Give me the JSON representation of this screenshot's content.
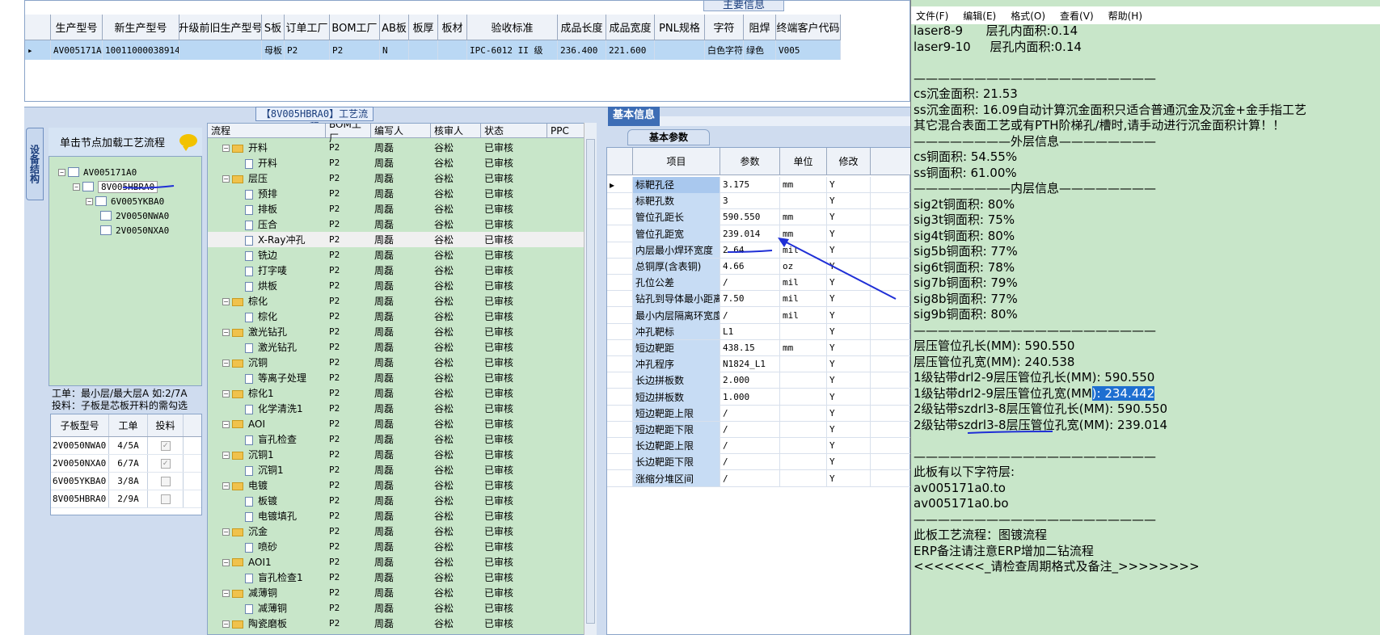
{
  "top_panel": {
    "tab_label": "主要信息",
    "headers": [
      "生产型号",
      "新生产型号",
      "升级前旧生产型号",
      "S板",
      "订单工厂",
      "BOM工厂",
      "AB板",
      "板厚",
      "板材",
      "验收标准",
      "成品长度",
      "成品宽度",
      "PNL规格",
      "字符",
      "阻焊",
      "终端客户代码"
    ],
    "row": [
      "AV005171A0",
      "10011000038914",
      "",
      "母板",
      "P2",
      "P2",
      "N",
      "",
      "",
      "IPC-6012 II 级",
      "236.400",
      "221.600",
      "",
      "白色字符",
      "绿色",
      "V005"
    ]
  },
  "side_tab": "设备结构",
  "tree_panel": {
    "header": "单击节点加载工艺流程",
    "nodes": [
      "AV005171A0",
      "8V005HBRA0",
      "6V005YKBA0",
      "2V0050NWA0",
      "2V0050NXA0"
    ]
  },
  "info_text": {
    "line1": "工单：最小层/最大层A 如:2/7A",
    "line2": "投料：子板是芯板开料的需勾选"
  },
  "child_grid": {
    "headers": [
      "子板型号",
      "工单",
      "投料"
    ],
    "rows": [
      {
        "model": "2V0050NWA0",
        "order": "4/5A",
        "checked": "✓"
      },
      {
        "model": "2V0050NXA0",
        "order": "6/7A",
        "checked": "✓"
      },
      {
        "model": "6V005YKBA0",
        "order": "3/8A",
        "checked": ""
      },
      {
        "model": "8V005HBRA0",
        "order": "2/9A",
        "checked": ""
      }
    ]
  },
  "process_panel": {
    "tab_label": "【8V005HBRA0】工艺流程",
    "headers": [
      "流程",
      "BOM工厂",
      "编写人",
      "核审人",
      "状态",
      "PPC"
    ],
    "rows": [
      {
        "name": "开料",
        "type": "folder",
        "bom": "P2",
        "writer": "周磊",
        "checker": "谷松",
        "status": "已审核"
      },
      {
        "name": "开料",
        "type": "doc",
        "bom": "P2",
        "writer": "周磊",
        "checker": "谷松",
        "status": "已审核"
      },
      {
        "name": "层压",
        "type": "folder",
        "bom": "P2",
        "writer": "周磊",
        "checker": "谷松",
        "status": "已审核"
      },
      {
        "name": "预排",
        "type": "doc",
        "bom": "P2",
        "writer": "周磊",
        "checker": "谷松",
        "status": "已审核"
      },
      {
        "name": "排板",
        "type": "doc",
        "bom": "P2",
        "writer": "周磊",
        "checker": "谷松",
        "status": "已审核"
      },
      {
        "name": "压合",
        "type": "doc",
        "bom": "P2",
        "writer": "周磊",
        "checker": "谷松",
        "status": "已审核"
      },
      {
        "name": "X-Ray冲孔",
        "type": "doc",
        "bom": "P2",
        "writer": "周磊",
        "checker": "谷松",
        "status": "已审核"
      },
      {
        "name": "铣边",
        "type": "doc",
        "bom": "P2",
        "writer": "周磊",
        "checker": "谷松",
        "status": "已审核"
      },
      {
        "name": "打字唛",
        "type": "doc",
        "bom": "P2",
        "writer": "周磊",
        "checker": "谷松",
        "status": "已审核"
      },
      {
        "name": "烘板",
        "type": "doc",
        "bom": "P2",
        "writer": "周磊",
        "checker": "谷松",
        "status": "已审核"
      },
      {
        "name": "棕化",
        "type": "folder",
        "bom": "P2",
        "writer": "周磊",
        "checker": "谷松",
        "status": "已审核"
      },
      {
        "name": "棕化",
        "type": "doc",
        "bom": "P2",
        "writer": "周磊",
        "checker": "谷松",
        "status": "已审核"
      },
      {
        "name": "激光钻孔",
        "type": "folder",
        "bom": "P2",
        "writer": "周磊",
        "checker": "谷松",
        "status": "已审核"
      },
      {
        "name": "激光钻孔",
        "type": "doc",
        "bom": "P2",
        "writer": "周磊",
        "checker": "谷松",
        "status": "已审核"
      },
      {
        "name": "沉铜",
        "type": "folder",
        "bom": "P2",
        "writer": "周磊",
        "checker": "谷松",
        "status": "已审核"
      },
      {
        "name": "等离子处理",
        "type": "doc",
        "bom": "P2",
        "writer": "周磊",
        "checker": "谷松",
        "status": "已审核"
      },
      {
        "name": "棕化1",
        "type": "folder",
        "bom": "P2",
        "writer": "周磊",
        "checker": "谷松",
        "status": "已审核"
      },
      {
        "name": "化学清洗1",
        "type": "doc",
        "bom": "P2",
        "writer": "周磊",
        "checker": "谷松",
        "status": "已审核"
      },
      {
        "name": "AOI",
        "type": "folder",
        "bom": "P2",
        "writer": "周磊",
        "checker": "谷松",
        "status": "已审核"
      },
      {
        "name": "盲孔检查",
        "type": "doc",
        "bom": "P2",
        "writer": "周磊",
        "checker": "谷松",
        "status": "已审核"
      },
      {
        "name": "沉铜1",
        "type": "folder",
        "bom": "P2",
        "writer": "周磊",
        "checker": "谷松",
        "status": "已审核"
      },
      {
        "name": "沉铜1",
        "type": "doc",
        "bom": "P2",
        "writer": "周磊",
        "checker": "谷松",
        "status": "已审核"
      },
      {
        "name": "电镀",
        "type": "folder",
        "bom": "P2",
        "writer": "周磊",
        "checker": "谷松",
        "status": "已审核"
      },
      {
        "name": "板镀",
        "type": "doc",
        "bom": "P2",
        "writer": "周磊",
        "checker": "谷松",
        "status": "已审核"
      },
      {
        "name": "电镀填孔",
        "type": "doc",
        "bom": "P2",
        "writer": "周磊",
        "checker": "谷松",
        "status": "已审核"
      },
      {
        "name": "沉金",
        "type": "folder",
        "bom": "P2",
        "writer": "周磊",
        "checker": "谷松",
        "status": "已审核"
      },
      {
        "name": "喷砂",
        "type": "doc",
        "bom": "P2",
        "writer": "周磊",
        "checker": "谷松",
        "status": "已审核"
      },
      {
        "name": "AOI1",
        "type": "folder",
        "bom": "P2",
        "writer": "周磊",
        "checker": "谷松",
        "status": "已审核"
      },
      {
        "name": "盲孔检查1",
        "type": "doc",
        "bom": "P2",
        "writer": "周磊",
        "checker": "谷松",
        "status": "已审核"
      },
      {
        "name": "减薄铜",
        "type": "folder",
        "bom": "P2",
        "writer": "周磊",
        "checker": "谷松",
        "status": "已审核"
      },
      {
        "name": "减薄铜",
        "type": "doc",
        "bom": "P2",
        "writer": "周磊",
        "checker": "谷松",
        "status": "已审核"
      },
      {
        "name": "陶瓷磨板",
        "type": "folder",
        "bom": "P2",
        "writer": "周磊",
        "checker": "谷松",
        "status": "已审核"
      }
    ]
  },
  "basic_panel": {
    "tab_label": "基本信息",
    "sub_tab": "基本参数",
    "headers": [
      "项目",
      "参数",
      "单位",
      "修改"
    ],
    "rows": [
      {
        "item": "标靶孔径",
        "value": "3.175",
        "unit": "mm",
        "mod": "Y"
      },
      {
        "item": "标靶孔数",
        "value": "3",
        "unit": "",
        "mod": "Y"
      },
      {
        "item": "管位孔距长",
        "value": "590.550",
        "unit": "mm",
        "mod": "Y"
      },
      {
        "item": "管位孔距宽",
        "value": "239.014",
        "unit": "mm",
        "mod": "Y"
      },
      {
        "item": "内层最小焊环宽度",
        "value": "2.64",
        "unit": "mil",
        "mod": "Y"
      },
      {
        "item": "总铜厚(含表铜)",
        "value": "4.66",
        "unit": "oz",
        "mod": "Y"
      },
      {
        "item": "孔位公差",
        "value": "/",
        "unit": "mil",
        "mod": "Y"
      },
      {
        "item": "钻孔到导体最小距离",
        "value": "7.50",
        "unit": "mil",
        "mod": "Y"
      },
      {
        "item": "最小内层隔离环宽度",
        "value": "/",
        "unit": "mil",
        "mod": "Y"
      },
      {
        "item": "冲孔靶标",
        "value": "L1",
        "unit": "",
        "mod": "Y"
      },
      {
        "item": "短边靶距",
        "value": "438.15",
        "unit": "mm",
        "mod": "Y"
      },
      {
        "item": "冲孔程序",
        "value": "N1824_L1",
        "unit": "",
        "mod": "Y"
      },
      {
        "item": "长边拼板数",
        "value": "2.000",
        "unit": "",
        "mod": "Y"
      },
      {
        "item": "短边拼板数",
        "value": "1.000",
        "unit": "",
        "mod": "Y"
      },
      {
        "item": "短边靶距上限",
        "value": "/",
        "unit": "",
        "mod": "Y"
      },
      {
        "item": "短边靶距下限",
        "value": "/",
        "unit": "",
        "mod": "Y"
      },
      {
        "item": "长边靶距上限",
        "value": "/",
        "unit": "",
        "mod": "Y"
      },
      {
        "item": "长边靶距下限",
        "value": "/",
        "unit": "",
        "mod": "Y"
      },
      {
        "item": "涨缩分堆区间",
        "value": "/",
        "unit": "",
        "mod": "Y"
      }
    ]
  },
  "notepad": {
    "menu": [
      "文件(F)",
      "编辑(E)",
      "格式(O)",
      "查看(V)",
      "帮助(H)"
    ],
    "lines": [
      "laser8-9      层孔内面积:0.14",
      "laser9-10     层孔内面积:0.14",
      "",
      "————————————————————",
      "cs沉金面积: 21.53",
      "ss沉金面积: 16.09自动计算沉金面积只适合普通沉金及沉金+金手指工艺",
      "其它混合表面工艺或有PTH阶梯孔/槽时,请手动进行沉金面积计算！！",
      "————————外层信息————————",
      "cs铜面积: 54.55%",
      "ss铜面积: 61.00%",
      "————————内层信息————————",
      "sig2t铜面积: 80%",
      "sig3t铜面积: 75%",
      "sig4t铜面积: 80%",
      "sig5b铜面积: 77%",
      "sig6t铜面积: 78%",
      "sig7b铜面积: 79%",
      "sig8b铜面积: 77%",
      "sig9b铜面积: 80%",
      "————————————————————",
      "层压管位孔长(MM): 590.550",
      "层压管位孔宽(MM): 240.538",
      "1级钻带drl2-9层压管位孔长(MM): 590.550",
      "1级钻带drl2-9层压管位孔宽(MM",
      "2级钻带szdrl3-8层压管位孔长(MM): 590.550",
      "2级钻带szdrl3-8层压管位孔宽(MM): 239.014",
      "",
      "————————————————————",
      "此板有以下字符层:",
      "av005171a0.to",
      "av005171a0.bo",
      "————————————————————",
      "此板工艺流程：图镀流程",
      "ERP备注请注意ERP增加二钻流程",
      "<<<<<<<_请检查周期格式及备注_>>>>>>>>"
    ],
    "selected_text": "): 234.442"
  }
}
